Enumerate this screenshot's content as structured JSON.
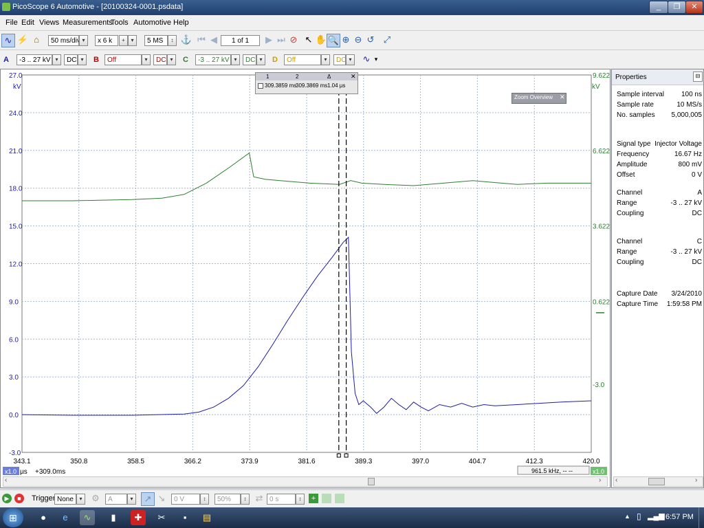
{
  "window": {
    "title": "PicoScope 6 Automotive - [20100324-0001.psdata]",
    "minimize": "_",
    "maximize": "❐",
    "close": "✕"
  },
  "menu": [
    "File",
    "Edit",
    "Views",
    "Measurements",
    "Tools",
    "Automotive",
    "Help"
  ],
  "toolbar1": {
    "timebase": "50 ms/div",
    "zoom": "x 6 k",
    "samples": "5 MS",
    "page": "1 of 1"
  },
  "toolbar2": {
    "chA": {
      "label": "A",
      "range": "-3 .. 27 kV",
      "coupling": "DC"
    },
    "chB": {
      "label": "B",
      "range": "Off",
      "coupling": "DC"
    },
    "chC": {
      "label": "C",
      "range": "-3 .. 27 kV",
      "coupling": "DC"
    },
    "chD": {
      "label": "D",
      "range": "Off",
      "coupling": "DC"
    }
  },
  "rulers": {
    "col1": "1",
    "col2": "2",
    "col3": "Δ",
    "val1": "309.3859 ms",
    "val2": "309.3869 ms",
    "delta": "1.04 µs"
  },
  "zoom_overview": "Zoom Overview",
  "x_offset": "+309.0ms",
  "x_unit": "µs",
  "freq_readout": "961.5 kHz, -- --",
  "scale_left": "x1.0",
  "scale_right": "x1.0",
  "properties": {
    "title": "Properties",
    "rows": [
      {
        "k": "Sample interval",
        "v": "100 ns"
      },
      {
        "k": "Sample rate",
        "v": "10 MS/s"
      },
      {
        "k": "No. samples",
        "v": "5,000,005"
      },
      {
        "k": "Signal type",
        "v": "Injector Voltage"
      },
      {
        "k": "Frequency",
        "v": "16.67 Hz"
      },
      {
        "k": "Amplitude",
        "v": "800 mV"
      },
      {
        "k": "Offset",
        "v": "0 V"
      },
      {
        "k": "Channel",
        "v": "A"
      },
      {
        "k": "Range",
        "v": "-3 .. 27 kV"
      },
      {
        "k": "Coupling",
        "v": "DC"
      },
      {
        "k": "Channel",
        "v": "C"
      },
      {
        "k": "Range",
        "v": "-3 .. 27 kV"
      },
      {
        "k": "Coupling",
        "v": "DC"
      },
      {
        "k": "Capture Date",
        "v": "3/24/2010"
      },
      {
        "k": "Capture Time",
        "v": "1:59:58 PM"
      }
    ]
  },
  "bottombar": {
    "trigger_label": "Trigger",
    "trigger_mode": "None",
    "trigger_channel": "A",
    "trigger_level": "0 V",
    "trigger_percent": "50%",
    "trigger_delay": "0 s"
  },
  "taskbar": {
    "clock": "6:57 PM"
  },
  "colors": {
    "chA": "#1c1ca8",
    "chC": "#2e7d32",
    "grid": "#9fb6d6"
  },
  "chart_data": {
    "type": "line",
    "xlim": [
      343.1,
      420.0
    ],
    "x_ticks": [
      "343.1",
      "350.8",
      "358.5",
      "366.2",
      "373.9",
      "381.6",
      "389.3",
      "397.0",
      "404.7",
      "412.3",
      "420.0"
    ],
    "left_axis": {
      "unit": "kV",
      "range": [
        -3.0,
        27.0
      ],
      "ticks": [
        "27.0",
        "24.0",
        "21.0",
        "18.0",
        "15.0",
        "12.0",
        "9.0",
        "6.0",
        "3.0",
        "0.0",
        "-3.0"
      ]
    },
    "right_axis": {
      "unit": "kV",
      "ticks": [
        "9.622",
        "6.622",
        "3.622",
        "0.622",
        "-3.0"
      ]
    },
    "cursors": [
      385.9,
      386.9
    ],
    "series": [
      {
        "channel": "A",
        "color": "#1c1ca8",
        "points": [
          [
            343.1,
            0.0
          ],
          [
            350,
            -0.05
          ],
          [
            358,
            -0.05
          ],
          [
            365,
            0.05
          ],
          [
            367,
            0.2
          ],
          [
            369,
            0.6
          ],
          [
            371,
            1.3
          ],
          [
            373,
            2.3
          ],
          [
            375,
            3.8
          ],
          [
            377,
            5.6
          ],
          [
            379,
            7.5
          ],
          [
            381,
            9.3
          ],
          [
            383,
            11.0
          ],
          [
            385,
            12.5
          ],
          [
            386.5,
            13.7
          ],
          [
            387.2,
            14.1
          ],
          [
            387.6,
            5.0
          ],
          [
            388.1,
            1.7
          ],
          [
            388.6,
            0.8
          ],
          [
            389.2,
            1.1
          ],
          [
            390.2,
            0.6
          ],
          [
            391,
            0.1
          ],
          [
            392,
            0.6
          ],
          [
            393,
            1.3
          ],
          [
            394,
            0.8
          ],
          [
            395,
            0.4
          ],
          [
            396,
            1.0
          ],
          [
            397,
            0.6
          ],
          [
            398,
            0.3
          ],
          [
            399.5,
            0.8
          ],
          [
            401,
            0.6
          ],
          [
            402.5,
            0.9
          ],
          [
            404,
            0.6
          ],
          [
            405.5,
            0.8
          ],
          [
            407,
            0.7
          ],
          [
            410,
            0.8
          ],
          [
            413,
            0.9
          ],
          [
            416,
            1.0
          ],
          [
            420,
            1.1
          ]
        ]
      },
      {
        "channel": "C",
        "color": "#2e7d32",
        "points": [
          [
            343.1,
            17.0
          ],
          [
            350,
            17.0
          ],
          [
            358,
            17.1
          ],
          [
            362,
            17.2
          ],
          [
            365,
            17.5
          ],
          [
            368,
            18.4
          ],
          [
            371,
            19.6
          ],
          [
            373.8,
            20.8
          ],
          [
            374.4,
            18.9
          ],
          [
            376,
            18.7
          ],
          [
            378,
            18.6
          ],
          [
            382,
            18.4
          ],
          [
            386,
            18.3
          ],
          [
            387.5,
            18.6
          ],
          [
            389,
            18.4
          ],
          [
            392,
            18.3
          ],
          [
            396,
            18.2
          ],
          [
            400,
            18.4
          ],
          [
            404,
            18.6
          ],
          [
            406,
            18.5
          ],
          [
            410,
            18.3
          ],
          [
            414,
            18.4
          ],
          [
            418,
            18.4
          ],
          [
            420,
            18.4
          ]
        ]
      }
    ]
  }
}
